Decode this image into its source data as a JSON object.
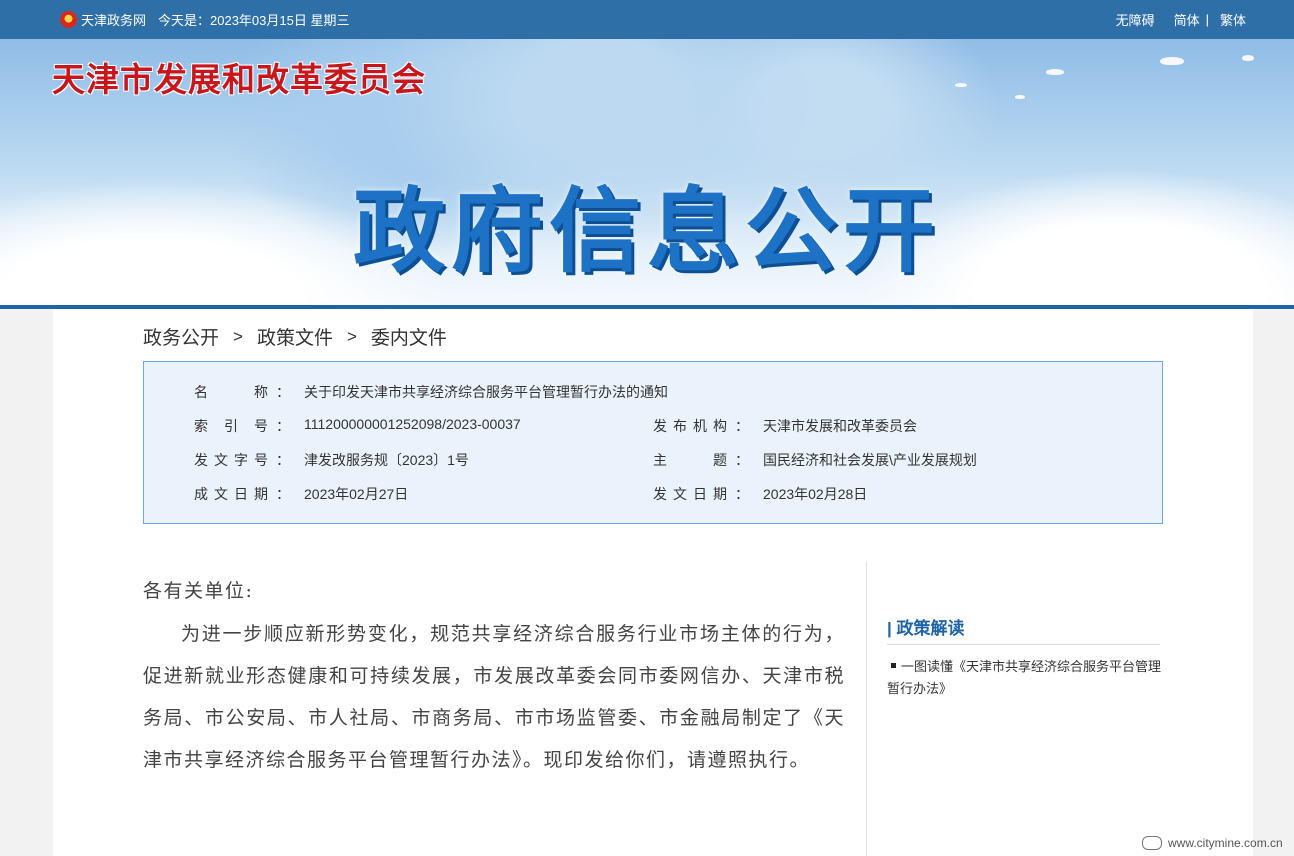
{
  "topbar": {
    "portal": "天津政务网",
    "date": "今天是：2023年03月15日 星期三",
    "accessibility": "无障碍",
    "simplified": "简体",
    "separator": "|",
    "traditional": "繁体"
  },
  "banner": {
    "org_name": "天津市发展和改革委员会",
    "hero_title": "政府信息公开"
  },
  "breadcrumb": {
    "items": [
      "政务公开",
      "委内文件"
    ],
    "middle": "政策文件",
    "arrow": ">"
  },
  "meta": {
    "name_label": "名　　称",
    "name_value": "关于印发天津市共享经济综合服务平台管理暂行办法的通知",
    "index_label": "索 引 号",
    "index_value": "111200000001252098/2023-00037",
    "publisher_label": "发布机构",
    "publisher_value": "天津市发展和改革委员会",
    "docno_label": "发文字号",
    "docno_value": "津发改服务规〔2023〕1号",
    "topic_label": "主　　题",
    "topic_value": "国民经济和社会发展\\产业发展规划",
    "created_label": "成文日期",
    "created_value": "2023年02月27日",
    "issued_label": "发文日期",
    "issued_value": "2023年02月28日",
    "colon": "："
  },
  "content": {
    "salutation": "各有关单位:",
    "paragraph": "为进一步顺应新形势变化，规范共享经济综合服务行业市场主体的行为，促进新就业形态健康和可持续发展，市发展改革委会同市委网信办、天津市税务局、市公安局、市人社局、市商务局、市市场监管委、市金融局制定了《天津市共享经济综合服务平台管理暂行办法》。现印发给你们，请遵照执行。"
  },
  "sidebar": {
    "title": "| 政策解读",
    "item": "一图读懂《天津市共享经济综合服务平台管理暂行办法》"
  },
  "watermark": "www.citymine.com.cn"
}
